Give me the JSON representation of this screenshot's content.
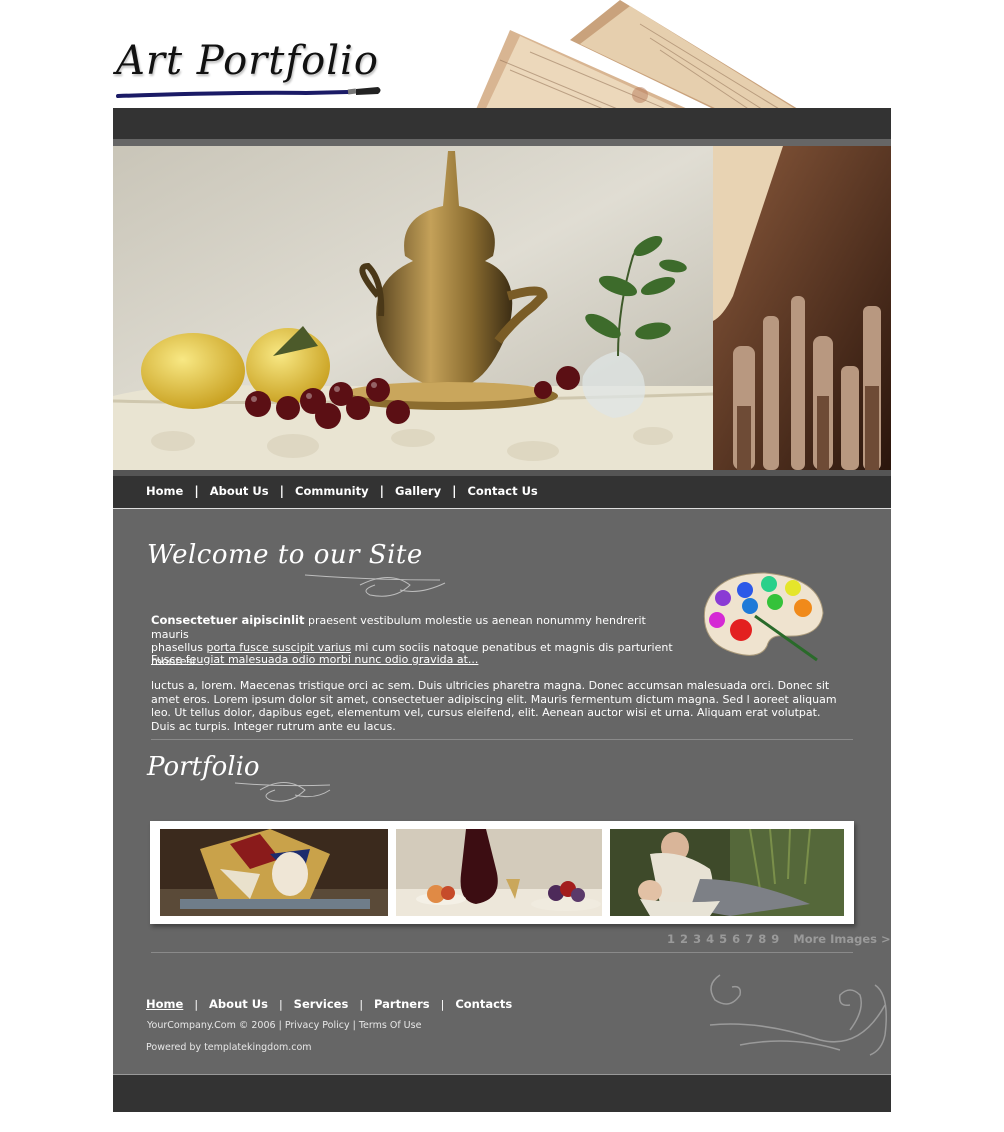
{
  "site": {
    "logo_text": "Art Portfolio"
  },
  "nav": {
    "items": [
      {
        "label": "Home"
      },
      {
        "label": "About Us"
      },
      {
        "label": "Community"
      },
      {
        "label": "Gallery"
      },
      {
        "label": "Contact Us"
      }
    ],
    "separator": "|"
  },
  "welcome": {
    "heading": "Welcome to our Site",
    "intro_bold": "Consectetuer aipiscinlit",
    "intro_rest_1": " praesent vestibulum molestie us aenean nonummy hendrerit mauris",
    "intro_line2_pre": " phasellus ",
    "intro_link": "porta fusce suscipit varius",
    "intro_line2_post": " mi cum sociis natoque penatibus et magnis dis parturient montesi.",
    "feature_link": "Fusce feugiat malesuada odio morbi nunc odio gravida at...",
    "body": "luctus a, lorem. Maecenas tristique orci ac sem. Duis ultricies pharetra magna. Donec accumsan malesuada orci. Donec sit amet eros. Lorem ipsum dolor sit amet, consectetuer adipiscing elit. Mauris fermentum dictum magna. Sed l aoreet aliquam leo. Ut tellus dolor, dapibus eget, elementum vel, cursus eleifend, elit. Aenean auctor wisi et urna. Aliquam erat volutpat. Duis ac turpis. Integer rutrum ante eu lacus."
  },
  "portfolio": {
    "heading": "Portfolio",
    "pages": [
      "1",
      "2",
      "3",
      "4",
      "5",
      "6",
      "7",
      "8",
      "9"
    ],
    "more_label": "More Images >"
  },
  "footer": {
    "nav": [
      {
        "label": "Home"
      },
      {
        "label": "About Us"
      },
      {
        "label": "Services"
      },
      {
        "label": "Partners"
      },
      {
        "label": "Contacts"
      }
    ],
    "separator": "|",
    "copyright": "YourCompany.Com © 2006",
    "privacy": "Privacy Policy",
    "terms": "Terms Of Use",
    "divider": "|",
    "powered": "Powered by templatekingdom.com"
  },
  "colors": {
    "dark_band": "#333333",
    "content_bg": "#666666",
    "text": "#ffffff",
    "pager": "#9a9a9a"
  }
}
